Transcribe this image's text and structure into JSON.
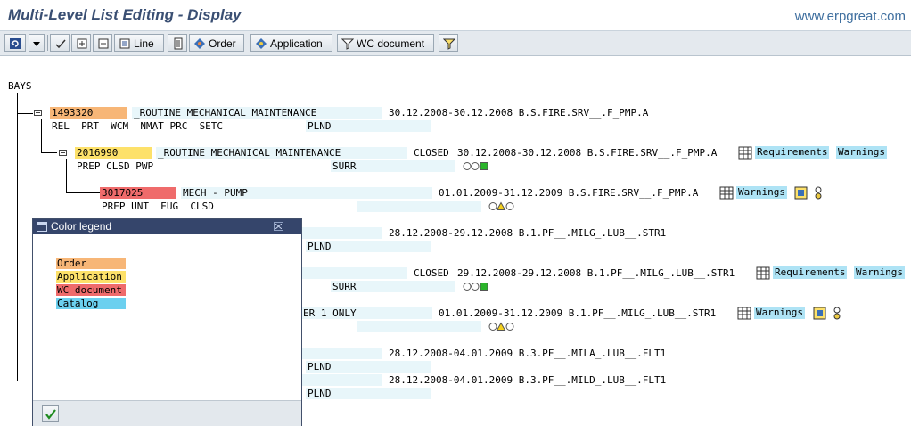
{
  "app": {
    "title": "Multi-Level List Editing - Display",
    "watermark": "www.erpgreat.com"
  },
  "toolbar": {
    "line_label": "Line",
    "order_label": "Order",
    "application_label": "Application",
    "wc_document_label": "WC document"
  },
  "tree": {
    "root": "BAYS",
    "rows": [
      {
        "id": "r1",
        "number": "1493320",
        "desc": "_ROUTINE MECHANICAL MAINTENANCE",
        "status": "",
        "period": "30.12.2008-30.12.2008 B.S.FIRE.SRV__.F_PMP.A",
        "sub": "REL  PRT  WCM  NMAT PRC  SETC",
        "sub2": "PLND",
        "type": "order"
      },
      {
        "id": "r2",
        "number": "2016990",
        "desc": "_ROUTINE MECHANICAL MAINTENANCE",
        "status": "CLOSED",
        "period": "30.12.2008-30.12.2008 B.S.FIRE.SRV__.F_PMP.A",
        "sub": "PREP CLSD PWP",
        "sub2": "SURR",
        "type": "application",
        "chips": [
          "Requirements",
          "Warnings"
        ]
      },
      {
        "id": "r3",
        "number": "3017025",
        "desc": "MECH - PUMP",
        "status": "",
        "period": "01.01.2009-31.12.2009 B.S.FIRE.SRV__.F_PMP.A",
        "sub": "PREP UNT  EUG  CLSD",
        "sub2": "",
        "type": "wc",
        "chips": [
          "Warnings"
        ]
      },
      {
        "id": "r4",
        "period": "28.12.2008-29.12.2008 B.1.PF__.MILG_.LUB__.STR1",
        "sub2": "PLND"
      },
      {
        "id": "r5",
        "status": "CLOSED",
        "period": "29.12.2008-29.12.2008 B.1.PF__.MILG_.LUB__.STR1",
        "sub2": "SURR",
        "chips": [
          "Requirements",
          "Warnings"
        ]
      },
      {
        "id": "r6",
        "desc_tail": "ER 1 ONLY",
        "period": "01.01.2009-31.12.2009 B.1.PF__.MILG_.LUB__.STR1",
        "chips": [
          "Warnings"
        ]
      },
      {
        "id": "r7",
        "period": "28.12.2008-04.01.2009 B.3.PF__.MILA_.LUB__.FLT1",
        "sub2": "PLND"
      },
      {
        "id": "r8",
        "period": "28.12.2008-04.01.2009 B.3.PF__.MILD_.LUB__.FLT1",
        "sub2": "PLND"
      }
    ]
  },
  "legend": {
    "title": "Color legend",
    "items": [
      {
        "label": "Order",
        "color": "#f7b677"
      },
      {
        "label": "Application",
        "color": "#fde16a"
      },
      {
        "label": "WC document",
        "color": "#ef6b6b"
      },
      {
        "label": "Catalog",
        "color": "#6cd0ef"
      }
    ]
  },
  "colors": {
    "order": "#f7b677",
    "application": "#fde16a",
    "wc_document": "#ef6b6b",
    "catalog": "#6cd0ef",
    "chip": "#aee3f5",
    "field": "#e8f6fa"
  }
}
